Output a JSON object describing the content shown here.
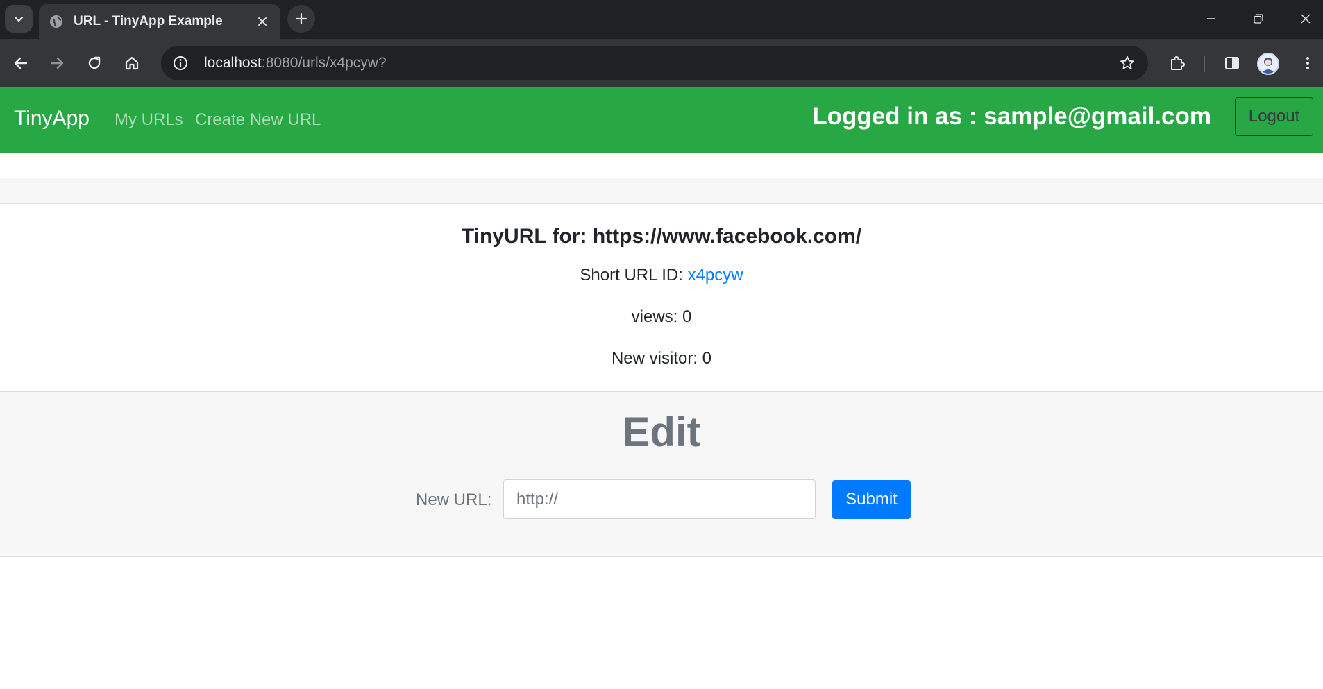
{
  "browser": {
    "tab_title": "URL - TinyApp Example",
    "url_host": "localhost",
    "url_path": ":8080/urls/x4pcyw?",
    "icons": {
      "tab_search": "chevron-down-icon",
      "favicon": "globe-icon",
      "tab_close": "close-icon",
      "new_tab": "plus-icon",
      "back": "arrow-left-icon",
      "forward": "arrow-right-icon",
      "reload": "reload-icon",
      "home": "home-icon",
      "site_info": "info-icon",
      "bookmark": "star-icon",
      "extensions": "puzzle-icon",
      "side_panel": "side-panel-icon",
      "profile": "avatar",
      "menu": "kebab-menu-icon",
      "minimize": "minimize-icon",
      "restore": "restore-icon",
      "close_window": "close-icon"
    }
  },
  "navbar": {
    "brand": "TinyApp",
    "links": [
      "My URLs",
      "Create New URL"
    ],
    "logged_in_text": "Logged in as : sample@gmail.com",
    "logout_label": "Logout",
    "bg_color": "#28a745"
  },
  "url_card": {
    "title": "TinyURL for: https://www.facebook.com/",
    "short_id_label": "Short URL ID: ",
    "short_id": "x4pcyw",
    "views_text": "views: 0",
    "visitors_text": "New visitor: 0"
  },
  "edit": {
    "heading": "Edit",
    "label": "New URL:",
    "placeholder": "http://",
    "submit_label": "Submit"
  }
}
